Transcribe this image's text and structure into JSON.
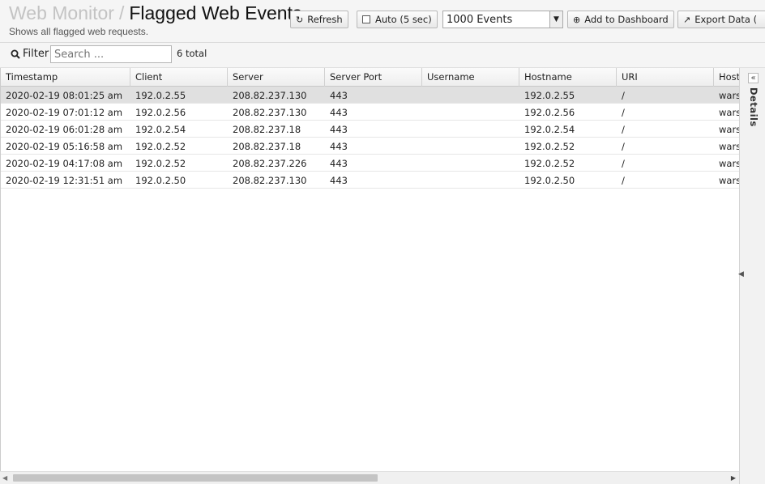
{
  "header": {
    "breadcrumb_parent": "Web Monitor",
    "separator": "/",
    "title": "Flagged Web Events",
    "subtitle": "Shows all flagged web requests."
  },
  "toolbar": {
    "refresh_label": "Refresh",
    "auto_label": "Auto (5 sec)",
    "auto_checked": false,
    "events_selected": "1000 Events",
    "add_dashboard_label": "Add to Dashboard",
    "export_label": "Export Data ("
  },
  "filter": {
    "label": "Filter",
    "placeholder": "Search ...",
    "total": "6 total"
  },
  "table": {
    "columns": [
      "Timestamp",
      "Client",
      "Server",
      "Server Port",
      "Username",
      "Hostname",
      "URI",
      "Host"
    ],
    "rows": [
      [
        "2020-02-19 08:01:25 am",
        "192.0.2.55",
        "208.82.237.130",
        "443",
        "",
        "192.0.2.55",
        "/",
        "wars"
      ],
      [
        "2020-02-19 07:01:12 am",
        "192.0.2.56",
        "208.82.237.130",
        "443",
        "",
        "192.0.2.56",
        "/",
        "wars"
      ],
      [
        "2020-02-19 06:01:28 am",
        "192.0.2.54",
        "208.82.237.18",
        "443",
        "",
        "192.0.2.54",
        "/",
        "wars"
      ],
      [
        "2020-02-19 05:16:58 am",
        "192.0.2.52",
        "208.82.237.18",
        "443",
        "",
        "192.0.2.52",
        "/",
        "wars"
      ],
      [
        "2020-02-19 04:17:08 am",
        "192.0.2.52",
        "208.82.237.226",
        "443",
        "",
        "192.0.2.52",
        "/",
        "wars"
      ],
      [
        "2020-02-19 12:31:51 am",
        "192.0.2.50",
        "208.82.237.130",
        "443",
        "",
        "192.0.2.50",
        "/",
        "wars"
      ]
    ],
    "selected_row": 0
  },
  "details_panel": {
    "label": "Details"
  },
  "colors": {
    "header_bg": "#f5f5f5",
    "selected_row": "#e0e0e0",
    "breadcrumb_parent": "#c3c3c3"
  }
}
